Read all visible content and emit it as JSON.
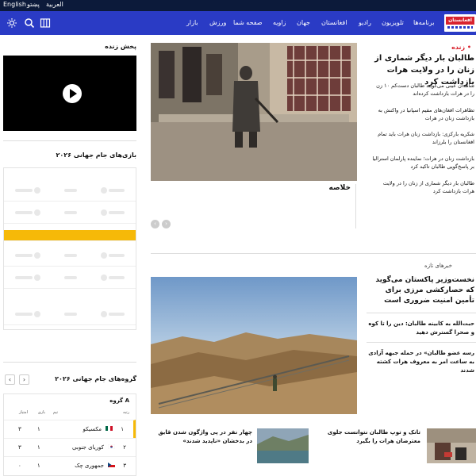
{
  "lang_bar": {
    "english": "English",
    "pashto": "پښتو",
    "arabic": "العربية"
  },
  "nav": {
    "logo_text": "افغانستان",
    "items": [
      "برنامه‌ها",
      "تلویزیون",
      "رادیو",
      "افغانستان",
      "جهان",
      "زاویه",
      "صفحه شما",
      "ورزش",
      "بازار"
    ]
  },
  "left": {
    "live_title": "پخش زنده",
    "games_title": "بازی‌های جام جهانی ۲۰۲۶",
    "groups_title": "گروه‌های جام جهانی ۲۰۲۶",
    "group_label": "گروه A",
    "table_headers": [
      "رتبه",
      "تیم",
      "بازی",
      "امتیاز"
    ],
    "table_rows": [
      {
        "rank": "۱",
        "team": "مکسیکو",
        "played": "۱",
        "points": "۳",
        "flag": "mexico-flag"
      },
      {
        "rank": "۲",
        "team": "کوریای جنوبی",
        "played": "۱",
        "points": "۳",
        "flag": "korea-flag"
      },
      {
        "rank": "۳",
        "team": "جمهوری چک",
        "played": "۱",
        "points": "۰",
        "flag": "czech-flag"
      }
    ]
  },
  "center": {
    "summary": "خلاصه",
    "bottom_stories": [
      "تانک و توپ طالبان نتوانست جلوی معترضان هرات را بگیرد",
      "چهار نفر در پی واژگون شدن قایق در بدخشان «ناپدید شدند»"
    ]
  },
  "right": {
    "live_tag": "• زنده",
    "main_headline": "طالبان بار دیگر شماری از زنان را در ولایت هرات بازداشت کرد",
    "sub_headlines": [
      "شاهدان عینی می‌گویند طالبان دست‌کم ۱۰ زن را در هرات بازداشت کرده‌اند",
      "تظاهرات افغان‌های مقیم اسپانیا در واکنش به بازداشت زنان در هرات",
      "شکریه بارکزی: بازداشت زنان هرات باید تمام افغانستان را بلرزاند",
      "بازداشت زنان در هرات؛ نماینده پارلمان استرالیا بر پاسخ‌گویی طالبان تاکید کرد",
      "طالبان بار دیگر شماری از زنان را در ولایت هرات بازداشت کرد"
    ],
    "news_title": "خبرهای تازه",
    "news_main": "نخست‌وزیر پاکستان می‌گوید که حصارکشی مرزی برای تأمین امنیت ضروری است",
    "news_items": [
      "حبت‌الله به کابینه طالبان: دین را تا کوه و صحرا گسترش دهید",
      "رسه عضو طالبان» در حمله جبهه آزادی به ساعت امر به معروف هرات کشته شدند"
    ]
  },
  "colors": {
    "nav_bg": "#2a3bc5",
    "lang_bg": "#0c1a3a",
    "accent": "#d9232e",
    "highlight": "#f6b908"
  }
}
